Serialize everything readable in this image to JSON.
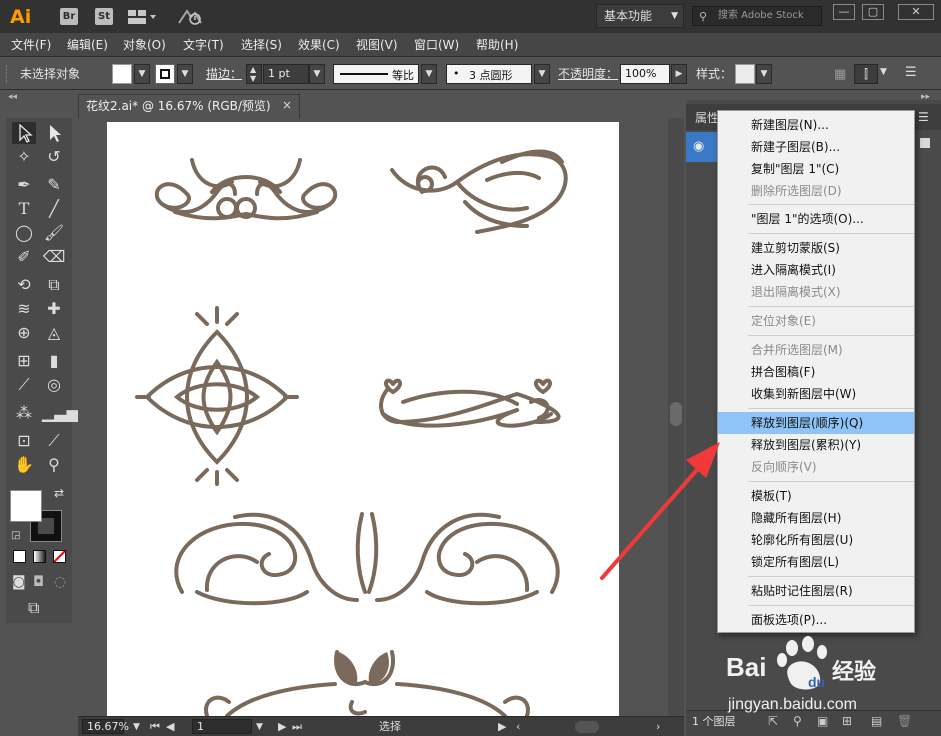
{
  "app": {
    "logo": "Ai",
    "bridge_btn": "Br",
    "stock_btn": "St",
    "workspace": "基本功能",
    "stock_search_placeholder": "搜索 Adobe Stock"
  },
  "menubar": [
    "文件(F)",
    "编辑(E)",
    "对象(O)",
    "文字(T)",
    "选择(S)",
    "效果(C)",
    "视图(V)",
    "窗口(W)",
    "帮助(H)"
  ],
  "control": {
    "selection_status": "未选择对象",
    "stroke_label": "描边：",
    "stroke_weight": "1 pt",
    "stroke_profile": "等比",
    "brush": "3 点圆形",
    "opacity_label": "不透明度：",
    "opacity_value": "100%",
    "style_label": "样式："
  },
  "document": {
    "tab_title": "花纹2.ai* @ 16.67% (RGB/预览)",
    "close_glyph": "×"
  },
  "statusbar": {
    "zoom": "16.67%",
    "page": "1",
    "tool_status": "选择"
  },
  "panel": {
    "tab_label": "属性",
    "layer_count": "1 个图层"
  },
  "context_menu": {
    "items": [
      {
        "label": "新建图层(N)...",
        "enabled": true
      },
      {
        "label": "新建子图层(B)...",
        "enabled": true
      },
      {
        "label": "复制\"图层 1\"(C)",
        "enabled": true
      },
      {
        "label": "删除所选图层(D)",
        "enabled": false
      },
      {
        "label": "\"图层 1\"的选项(O)...",
        "enabled": true
      },
      {
        "label": "建立剪切蒙版(S)",
        "enabled": true
      },
      {
        "label": "进入隔离模式(I)",
        "enabled": true
      },
      {
        "label": "退出隔离模式(X)",
        "enabled": false
      },
      {
        "label": "定位对象(E)",
        "enabled": false
      },
      {
        "label": "合并所选图层(M)",
        "enabled": false
      },
      {
        "label": "拼合图稿(F)",
        "enabled": true
      },
      {
        "label": "收集到新图层中(W)",
        "enabled": true
      },
      {
        "label": "释放到图层(顺序)(Q)",
        "enabled": true,
        "highlighted": true
      },
      {
        "label": "释放到图层(累积)(Y)",
        "enabled": true
      },
      {
        "label": "反向顺序(V)",
        "enabled": false
      },
      {
        "label": "模板(T)",
        "enabled": true
      },
      {
        "label": "隐藏所有图层(H)",
        "enabled": true
      },
      {
        "label": "轮廓化所有图层(U)",
        "enabled": true
      },
      {
        "label": "锁定所有图层(L)",
        "enabled": true
      },
      {
        "label": "粘贴时记住图层(R)",
        "enabled": true
      },
      {
        "label": "面板选项(P)...",
        "enabled": true
      }
    ]
  },
  "watermark": {
    "brand": "Bai",
    "brand2": "du",
    "brand_cn": "经验",
    "url": "jingyan.baidu.com"
  },
  "colors": {
    "ornament": "#7a6a5c",
    "highlight": "#8ec5f6",
    "arrow": "#f03a3a",
    "app_orange": "#ff9a00"
  }
}
